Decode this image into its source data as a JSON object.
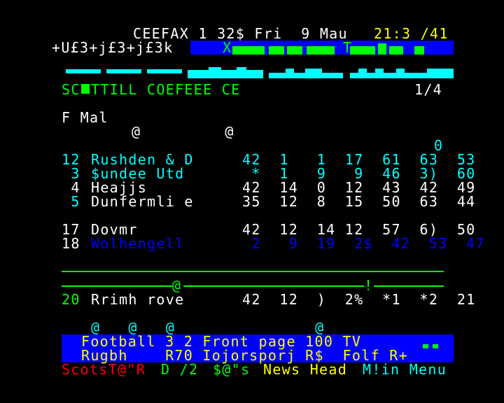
{
  "header": {
    "service": "CEEFAX 1 32$ Fri  9 Mau",
    "clock": "21:3 /41",
    "subline": "+U£3+j£3+j£3k",
    "banner_letters": [
      "X",
      "T"
    ]
  },
  "page": {
    "title": "SC",
    "title_rest": "TTILL COEFEEE CE",
    "page_counter": "1/4"
  },
  "table": {
    "section": "F Mal",
    "at_marks": "@         @",
    "zero_mark": "0",
    "rows": [
      {
        "pos": "12",
        "team": "Rushden & D",
        "stats": "42  1   1  17  61  63  53"
      },
      {
        "pos": " 3",
        "team": "$undee Utd",
        "stats": " *  1   9   9  46  3)  60"
      },
      {
        "pos": " 4",
        "team": "Heajjs",
        "stats": "42  14  0  12  43  42  49"
      },
      {
        "pos": " 5",
        "team": "Dunfermli e",
        "stats": "35  12  8  15  50  63  44"
      },
      {
        "pos": "17",
        "team": "Dovmr",
        "stats": "42  12  14 12  57  6)  50"
      },
      {
        "pos": "18",
        "team": "Wolhengell",
        "stats": " 2   9  19  2$  42  53  47"
      }
    ],
    "divider_marks": [
      "@",
      "!"
    ],
    "last_row": {
      "pos": "20",
      "team": "Rrimh rove",
      "stats": "42  12  )  2%  *1  *2  21"
    }
  },
  "footer": {
    "at_marks": "@   @   @               @",
    "nav_row1": "Football 3 2 Front page 100 TV",
    "nav_row2": "Rugbh    R70 Iojorsporj R$  Folf R+",
    "bottom": [
      {
        "text": "ScotsT@\"R",
        "color": "red"
      },
      {
        "text": "D /2",
        "color": "green"
      },
      {
        "text": "$@\"s",
        "color": "green"
      },
      {
        "text": "News Head",
        "color": "yellow"
      },
      {
        "text": "M!in Menu",
        "color": "cyan"
      }
    ]
  },
  "colors": {
    "background": "#000000",
    "cyan": "#00ffff",
    "green": "#00ff00",
    "yellow": "#ffff00",
    "red": "#ff0000",
    "blue": "#0000ff",
    "white": "#ffffff"
  }
}
